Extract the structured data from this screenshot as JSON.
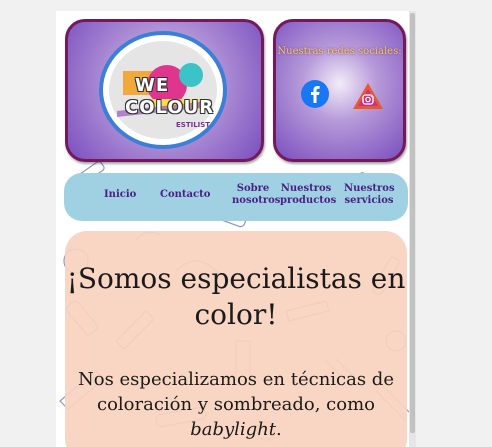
{
  "logo": {
    "line1": "WE",
    "line2": "COLOUR",
    "tagline": "ESTILISTOS"
  },
  "social": {
    "title": "Nuestras redes sociales:",
    "icons": [
      "facebook-icon",
      "instagram-icon"
    ]
  },
  "nav": {
    "inicio": "Inicio",
    "contacto": "Contacto",
    "sobre_line1": "Sobre",
    "sobre_line2": "nosotros",
    "productos_line1": "Nuestros",
    "productos_line2": "productos",
    "servicios_line1": "Nuestros",
    "servicios_line2": "servicios"
  },
  "main": {
    "heading": "¡Somos especialistas en color!",
    "paragraph_start": "Nos especializamos en técnicas de coloración y sombreado, como ",
    "paragraph_emphasis": "babylight",
    "paragraph_end": "."
  },
  "colors": {
    "purple_box": "#7a4fbf",
    "box_border": "#74195b",
    "nav_bg": "#9fd1e2",
    "nav_text": "#4a1e86",
    "content_bg": "#f8d2be",
    "social_title": "#f2c94c"
  }
}
